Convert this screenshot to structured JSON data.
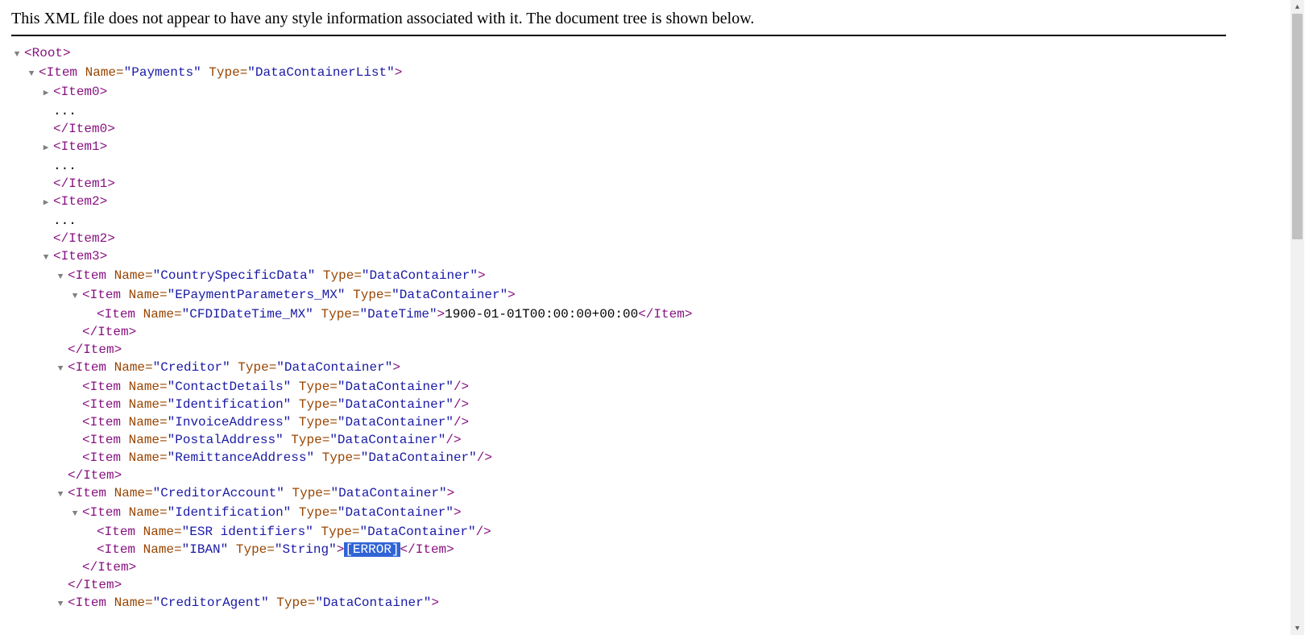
{
  "notice": "This XML file does not appear to have any style information associated with it. The document tree is shown below.",
  "ellipsis": "...",
  "tags": {
    "root": "Root",
    "item": "Item",
    "item0": "Item0",
    "item1": "Item1",
    "item2": "Item2",
    "item3": "Item3"
  },
  "attrs": {
    "name": "Name",
    "type": "Type"
  },
  "vals": {
    "payments": "Payments",
    "dataContainerList": "DataContainerList",
    "countrySpecificData": "CountrySpecificData",
    "dataContainer": "DataContainer",
    "ePaymentParameters_MX": "EPaymentParameters_MX",
    "cfdiDateTime_MX": "CFDIDateTime_MX",
    "dateTime": "DateTime",
    "creditor": "Creditor",
    "contactDetails": "ContactDetails",
    "identification": "Identification",
    "invoiceAddress": "InvoiceAddress",
    "postalAddress": "PostalAddress",
    "remittanceAddress": "RemittanceAddress",
    "creditorAccount": "CreditorAccount",
    "esrIdentifiers": "ESR identifiers",
    "iban": "IBAN",
    "string": "String",
    "creditorAgent": "CreditorAgent"
  },
  "text": {
    "cfdiDateTimeValue": "1900-01-01T00:00:00+00:00",
    "errorValue": "[ERROR]"
  },
  "scroll": {
    "up": "▲",
    "down": "▼"
  }
}
